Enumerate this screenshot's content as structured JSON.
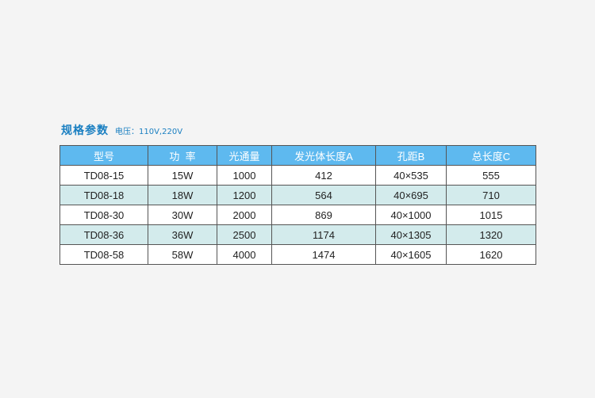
{
  "caption": {
    "title": "规格参数",
    "voltage": "电压：110V,220V"
  },
  "colors": {
    "header_bg": "#5eb9ef",
    "alt_row_bg": "#d3ebec",
    "caption_text": "#1a7fc1",
    "page_bg": "#f4f4f4"
  },
  "table": {
    "headers": [
      "型号",
      "功  率",
      "光通量",
      "发光体长度A",
      "孔距B",
      "总长度C"
    ],
    "rows": [
      [
        "TD08-15",
        "15W",
        "1000",
        "412",
        "40×535",
        "555"
      ],
      [
        "TD08-18",
        "18W",
        "1200",
        "564",
        "40×695",
        "710"
      ],
      [
        "TD08-30",
        "30W",
        "2000",
        "869",
        "40×1000",
        "1015"
      ],
      [
        "TD08-36",
        "36W",
        "2500",
        "1174",
        "40×1305",
        "1320"
      ],
      [
        "TD08-58",
        "58W",
        "4000",
        "1474",
        "40×1605",
        "1620"
      ]
    ]
  }
}
